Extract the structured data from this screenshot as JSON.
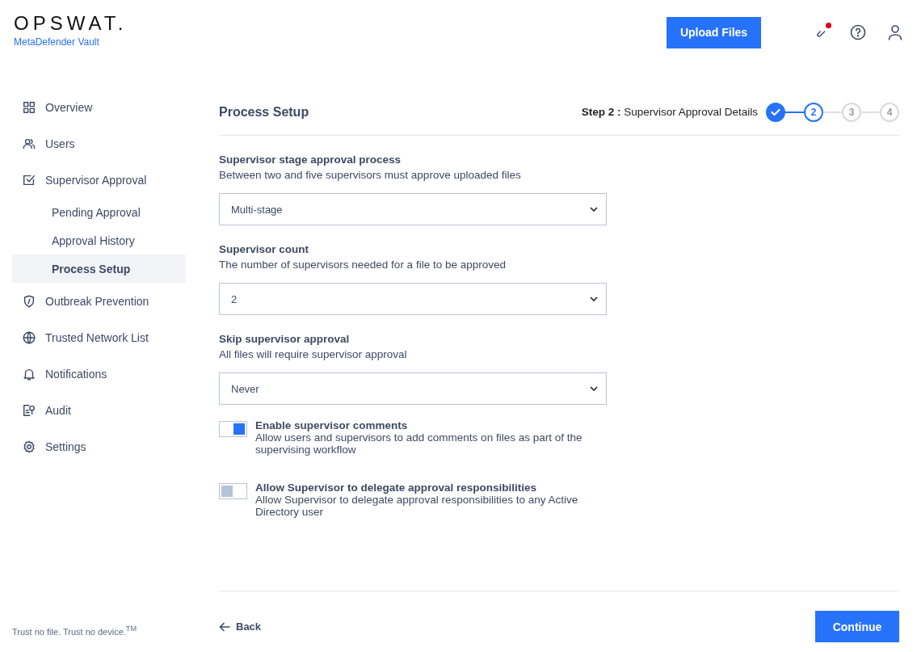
{
  "brand": {
    "logo": "OPSWAT.",
    "product": "MetaDefender Vault"
  },
  "header": {
    "upload_button": "Upload Files",
    "notification_dot": true
  },
  "sidebar": {
    "items": [
      {
        "label": "Overview",
        "selected": false
      },
      {
        "label": "Users",
        "selected": false
      },
      {
        "label": "Supervisor Approval",
        "selected": false,
        "children": [
          {
            "label": "Pending Approval",
            "selected": false
          },
          {
            "label": "Approval History",
            "selected": false
          },
          {
            "label": "Process Setup",
            "selected": true
          }
        ]
      },
      {
        "label": "Outbreak Prevention",
        "selected": false
      },
      {
        "label": "Trusted Network List",
        "selected": false
      },
      {
        "label": "Notifications",
        "selected": false
      },
      {
        "label": "Audit",
        "selected": false
      },
      {
        "label": "Settings",
        "selected": false
      }
    ],
    "footer": "Trust no file. Trust no device.$^{TM}$"
  },
  "page": {
    "title": "Process Setup",
    "step_caption": "**Step 2 :** Supervisor Approval Details",
    "steps": [
      {
        "completed": true,
        "selected": false
      },
      {
        "label": "2",
        "completed": false,
        "selected": true
      },
      {
        "label": "3",
        "completed": false,
        "selected": false
      },
      {
        "label": "4",
        "completed": false,
        "selected": false
      }
    ]
  },
  "fields": [
    {
      "label": "Supervisor stage approval process",
      "description": "Between two and five supervisors must approve uploaded files",
      "value": "Multi-stage"
    },
    {
      "label": "Supervisor count",
      "description": "The number of supervisors needed for a file to be approved",
      "value": "2"
    },
    {
      "label": "Skip supervisor approval",
      "description": "All files will require supervisor approval",
      "value": "Never"
    }
  ],
  "toggles": [
    {
      "label": "Enable supervisor comments",
      "description": "Allow users and supervisors to add comments on files as part of the supervising workflow",
      "on": true
    },
    {
      "label": "Allow Supervisor to delegate approval responsibilities",
      "description": "Allow Supervisor to delegate approval responsibilities to any Active Directory user",
      "on": false
    }
  ],
  "footer": {
    "back": "Back",
    "continue": "Continue"
  }
}
